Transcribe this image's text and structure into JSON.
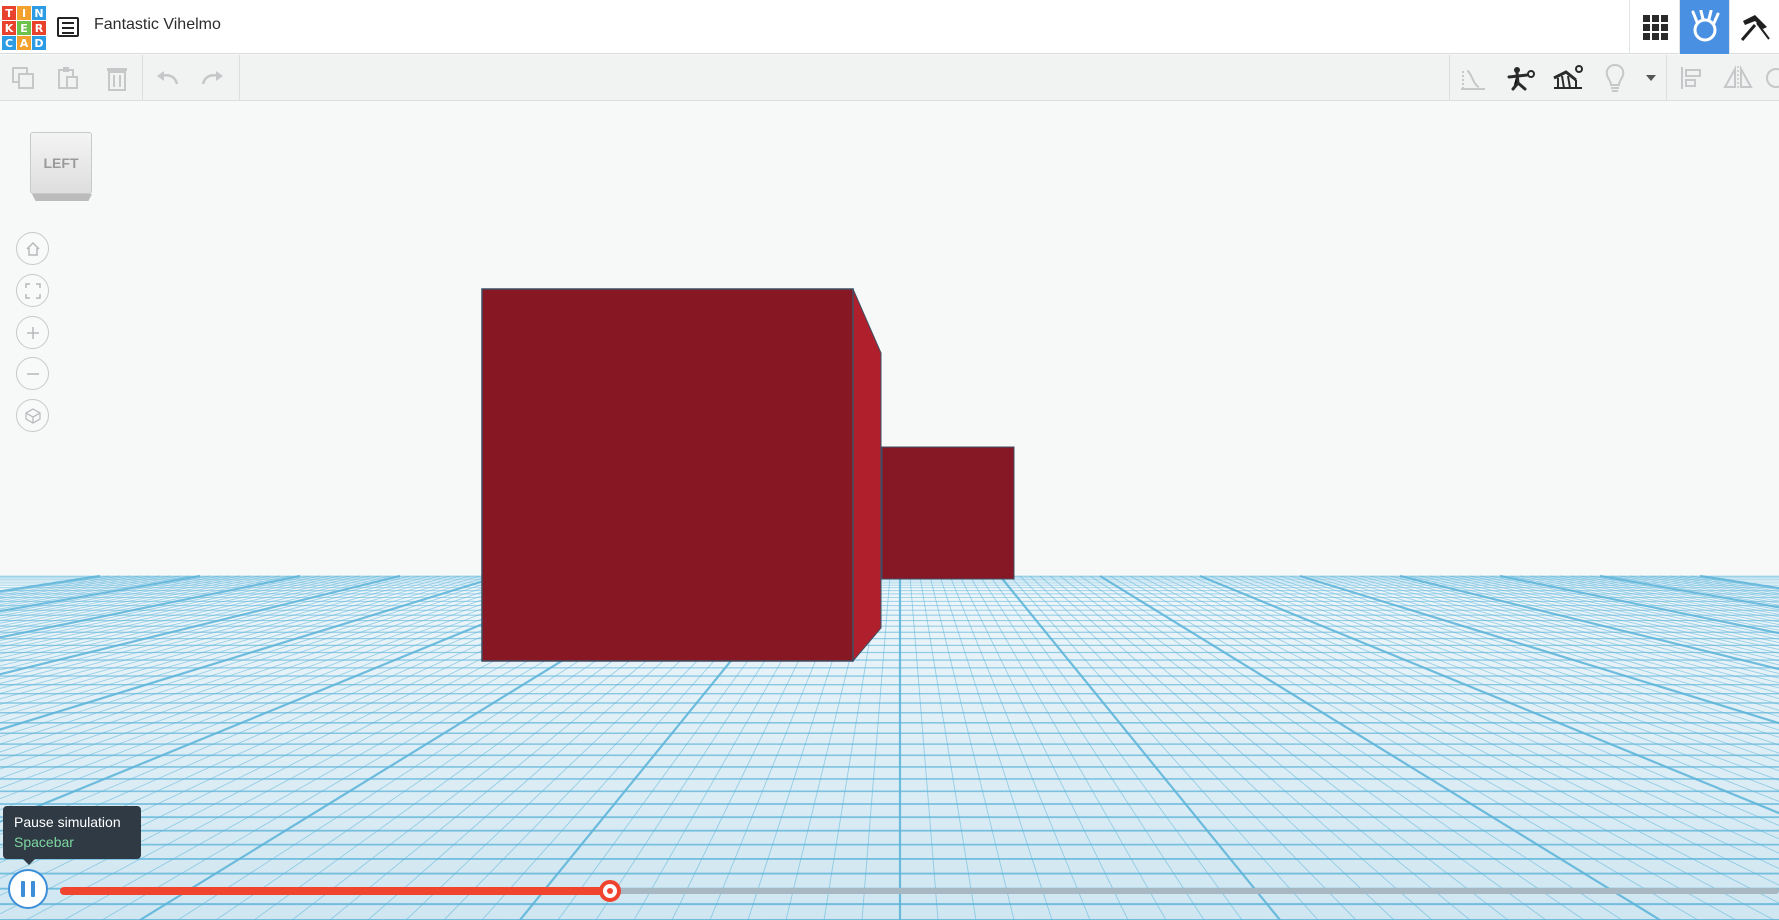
{
  "app": {
    "logo_letters": [
      "T",
      "I",
      "N",
      "K",
      "E",
      "R",
      "C",
      "A",
      "D"
    ],
    "logo_colors": [
      "#e8412c",
      "#f4a02c",
      "#2c9de4",
      "#e8412c",
      "#6cc24a",
      "#e8412c",
      "#2c9de4",
      "#f4a02c",
      "#2c9de4"
    ],
    "title": "Fantastic Vihelmo",
    "top_buttons": [
      {
        "name": "design-view-grid-icon",
        "active": false
      },
      {
        "name": "simulation-mode-icon",
        "active": true
      },
      {
        "name": "minecraft-pickaxe-icon",
        "active": false
      }
    ]
  },
  "toolbar": {
    "left_tools": [
      "copy-icon",
      "paste-icon",
      "delete-icon",
      "undo-icon",
      "redo-icon"
    ],
    "right_tools": [
      "physics-gravity-icon",
      "throw-object-icon",
      "simulation-settings-icon",
      "light-bulb-icon",
      "dropdown-caret-icon",
      "align-icon",
      "mirror-icon"
    ]
  },
  "viewport": {
    "view_cube_label": "LEFT",
    "nav_buttons": [
      "home-view-icon",
      "fit-view-icon",
      "zoom-in-icon",
      "zoom-out-icon",
      "perspective-icon"
    ],
    "colors": {
      "box_front": "#881723",
      "box_side": "#b01f2c",
      "grid_line": "#5ab3d9"
    }
  },
  "simulation": {
    "tooltip_title": "Pause simulation",
    "tooltip_shortcut": "Spacebar",
    "progress": 0.32,
    "colors": {
      "progress": "#f0442e",
      "pause": "#3d8ed8"
    }
  }
}
